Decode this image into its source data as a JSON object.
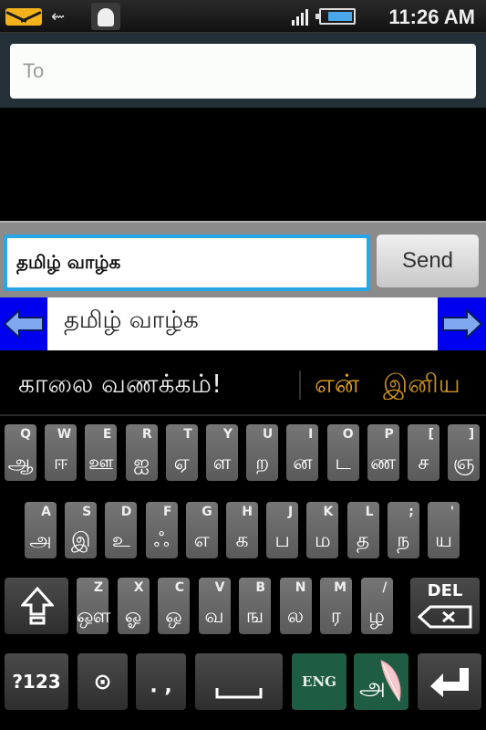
{
  "status_bar": {
    "icons": [
      "mail-icon",
      "usb-icon",
      "android-debug-icon",
      "signal-icon",
      "battery-charging-icon"
    ],
    "time": "11:26 AM"
  },
  "recipient": {
    "placeholder": "To",
    "value": ""
  },
  "compose": {
    "message": "தமிழ் வாழ்க",
    "send_label": "Send",
    "accent": "#29a6e8"
  },
  "transliteration_bar": {
    "left_icon": "arrow-left-icon",
    "text": "தமிழ் வாழ்க",
    "right_icon": "arrow-right-icon",
    "bg_color": "#0000f0"
  },
  "candidates": {
    "primary": "காலை வணக்கம்!",
    "secondary": [
      "என்",
      "இனிய"
    ],
    "secondary_color": "#e0a020"
  },
  "keyboard": {
    "rows": [
      [
        {
          "latin": "Q",
          "tamil": "ஆ"
        },
        {
          "latin": "W",
          "tamil": "ஈ"
        },
        {
          "latin": "E",
          "tamil": "ஊ"
        },
        {
          "latin": "R",
          "tamil": "ஐ"
        },
        {
          "latin": "T",
          "tamil": "ஏ"
        },
        {
          "latin": "Y",
          "tamil": "ள"
        },
        {
          "latin": "U",
          "tamil": "ற"
        },
        {
          "latin": "I",
          "tamil": "ன"
        },
        {
          "latin": "O",
          "tamil": "ட"
        },
        {
          "latin": "P",
          "tamil": "ண"
        },
        {
          "latin": "[",
          "tamil": "ச"
        },
        {
          "latin": "]",
          "tamil": "ஞ"
        }
      ],
      [
        {
          "latin": "A",
          "tamil": "அ"
        },
        {
          "latin": "S",
          "tamil": "இ"
        },
        {
          "latin": "D",
          "tamil": "உ"
        },
        {
          "latin": "F",
          "tamil": "ஃ"
        },
        {
          "latin": "G",
          "tamil": "எ"
        },
        {
          "latin": "H",
          "tamil": "க"
        },
        {
          "latin": "J",
          "tamil": "ப"
        },
        {
          "latin": "K",
          "tamil": "ம"
        },
        {
          "latin": "L",
          "tamil": "த"
        },
        {
          "latin": ";",
          "tamil": "ந"
        },
        {
          "latin": "'",
          "tamil": "ய"
        }
      ],
      [
        {
          "latin": "Z",
          "tamil": "ஔ"
        },
        {
          "latin": "X",
          "tamil": "ஓ"
        },
        {
          "latin": "C",
          "tamil": "ஒ"
        },
        {
          "latin": "V",
          "tamil": "வ"
        },
        {
          "latin": "B",
          "tamil": "ங"
        },
        {
          "latin": "N",
          "tamil": "ல"
        },
        {
          "latin": "M",
          "tamil": "ர"
        },
        {
          "latin": "/",
          "tamil": "ழ"
        }
      ]
    ],
    "shift_icon": "shift-icon",
    "delete_label": "DEL",
    "delete_icon": "backspace-icon",
    "symbols_label": "?123",
    "settings_icon": "settings-circle-icon",
    "punct_label": ". ,",
    "space_icon": "space-icon",
    "english_label": "ENG",
    "tamil_switch_label": "அ",
    "tamil_switch_icon": "quill-icon",
    "enter_icon": "enter-icon",
    "green_color": "#1f5c44"
  }
}
